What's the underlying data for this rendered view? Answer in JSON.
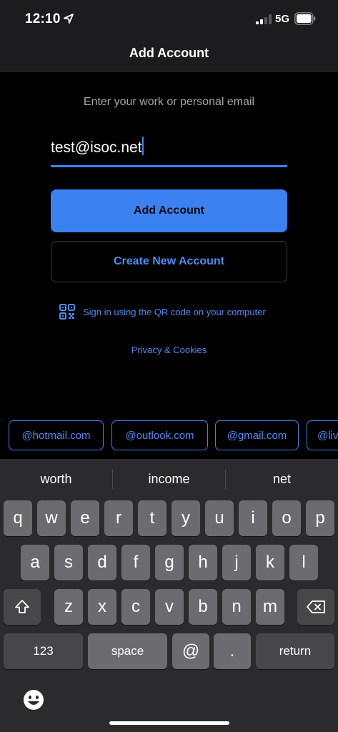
{
  "status_bar": {
    "time": "12:10",
    "network": "5G",
    "icons": [
      "location-arrow-icon",
      "signal-icon",
      "battery-icon"
    ]
  },
  "nav": {
    "title": "Add Account"
  },
  "form": {
    "prompt": "Enter your work or personal email",
    "email_value": "test@isoc.net",
    "add_button": "Add Account",
    "create_button": "Create New Account",
    "qr_text": "Sign in using the QR code on your computer",
    "privacy_link": "Privacy & Cookies"
  },
  "domain_chips": [
    "@hotmail.com",
    "@outlook.com",
    "@gmail.com",
    "@live"
  ],
  "keyboard": {
    "suggestions": [
      "worth",
      "income",
      "net"
    ],
    "row1": [
      "q",
      "w",
      "e",
      "r",
      "t",
      "y",
      "u",
      "i",
      "o",
      "p"
    ],
    "row2": [
      "a",
      "s",
      "d",
      "f",
      "g",
      "h",
      "j",
      "k",
      "l"
    ],
    "row3": [
      "z",
      "x",
      "c",
      "v",
      "b",
      "n",
      "m"
    ],
    "numbers_key": "123",
    "space_key": "space",
    "at_key": "@",
    "dot_key": ".",
    "return_key": "return"
  },
  "colors": {
    "accent": "#3b82f0",
    "link": "#4a8df5",
    "background": "#000000",
    "header": "#1c1c1e",
    "keyboard": "#2b2b2d",
    "key": "#6c6c70",
    "function_key": "#474749"
  }
}
